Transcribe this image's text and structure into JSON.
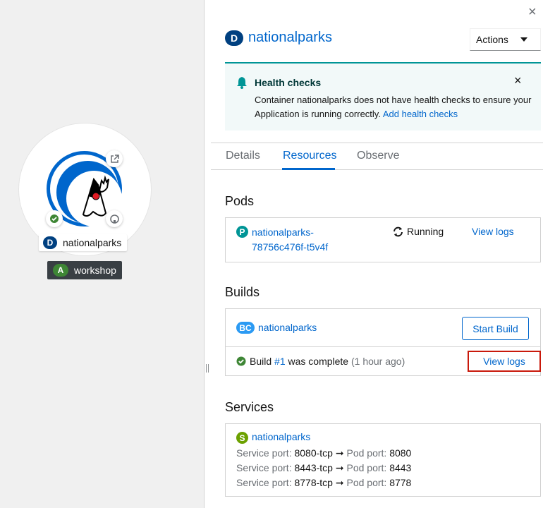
{
  "topology": {
    "node_label": "nationalparks",
    "node_badge": "D",
    "app_group_label": "workshop",
    "app_group_badge": "A"
  },
  "panel": {
    "close_glyph": "×",
    "title_badge": "D",
    "title": "nationalparks",
    "actions_label": "Actions",
    "alert": {
      "title": "Health checks",
      "body": "Container nationalparks does not have health checks to ensure your Application is running correctly.",
      "link": "Add health checks",
      "close_glyph": "×"
    },
    "tabs": [
      "Details",
      "Resources",
      "Observe"
    ],
    "active_tab": "Resources",
    "pods": {
      "title": "Pods",
      "badge": "P",
      "name_line1": "nationalparks-",
      "name_line2": "78756c476f-t5v4f",
      "status": "Running",
      "view_logs": "View logs"
    },
    "builds": {
      "title": "Builds",
      "badge": "BC",
      "name": "nationalparks",
      "start_build": "Start Build",
      "build_prefix": "Build",
      "build_number": "#1",
      "build_suffix": "was complete",
      "build_time": "(1 hour ago)",
      "view_logs": "View logs"
    },
    "services": {
      "title": "Services",
      "badge": "S",
      "name": "nationalparks",
      "service_port_label": "Service port:",
      "pod_port_label": "Pod port:",
      "ports": [
        {
          "service": "8080-tcp",
          "pod": "8080"
        },
        {
          "service": "8443-tcp",
          "pod": "8443"
        },
        {
          "service": "8778-tcp",
          "pod": "8778"
        }
      ]
    }
  },
  "colors": {
    "link": "#0066cc",
    "badge_d": "#004080",
    "badge_a": "#3e8635",
    "badge_p": "#009596",
    "badge_bc": "#2b9af3",
    "badge_s": "#6ca100",
    "highlight": "#c9190b"
  }
}
